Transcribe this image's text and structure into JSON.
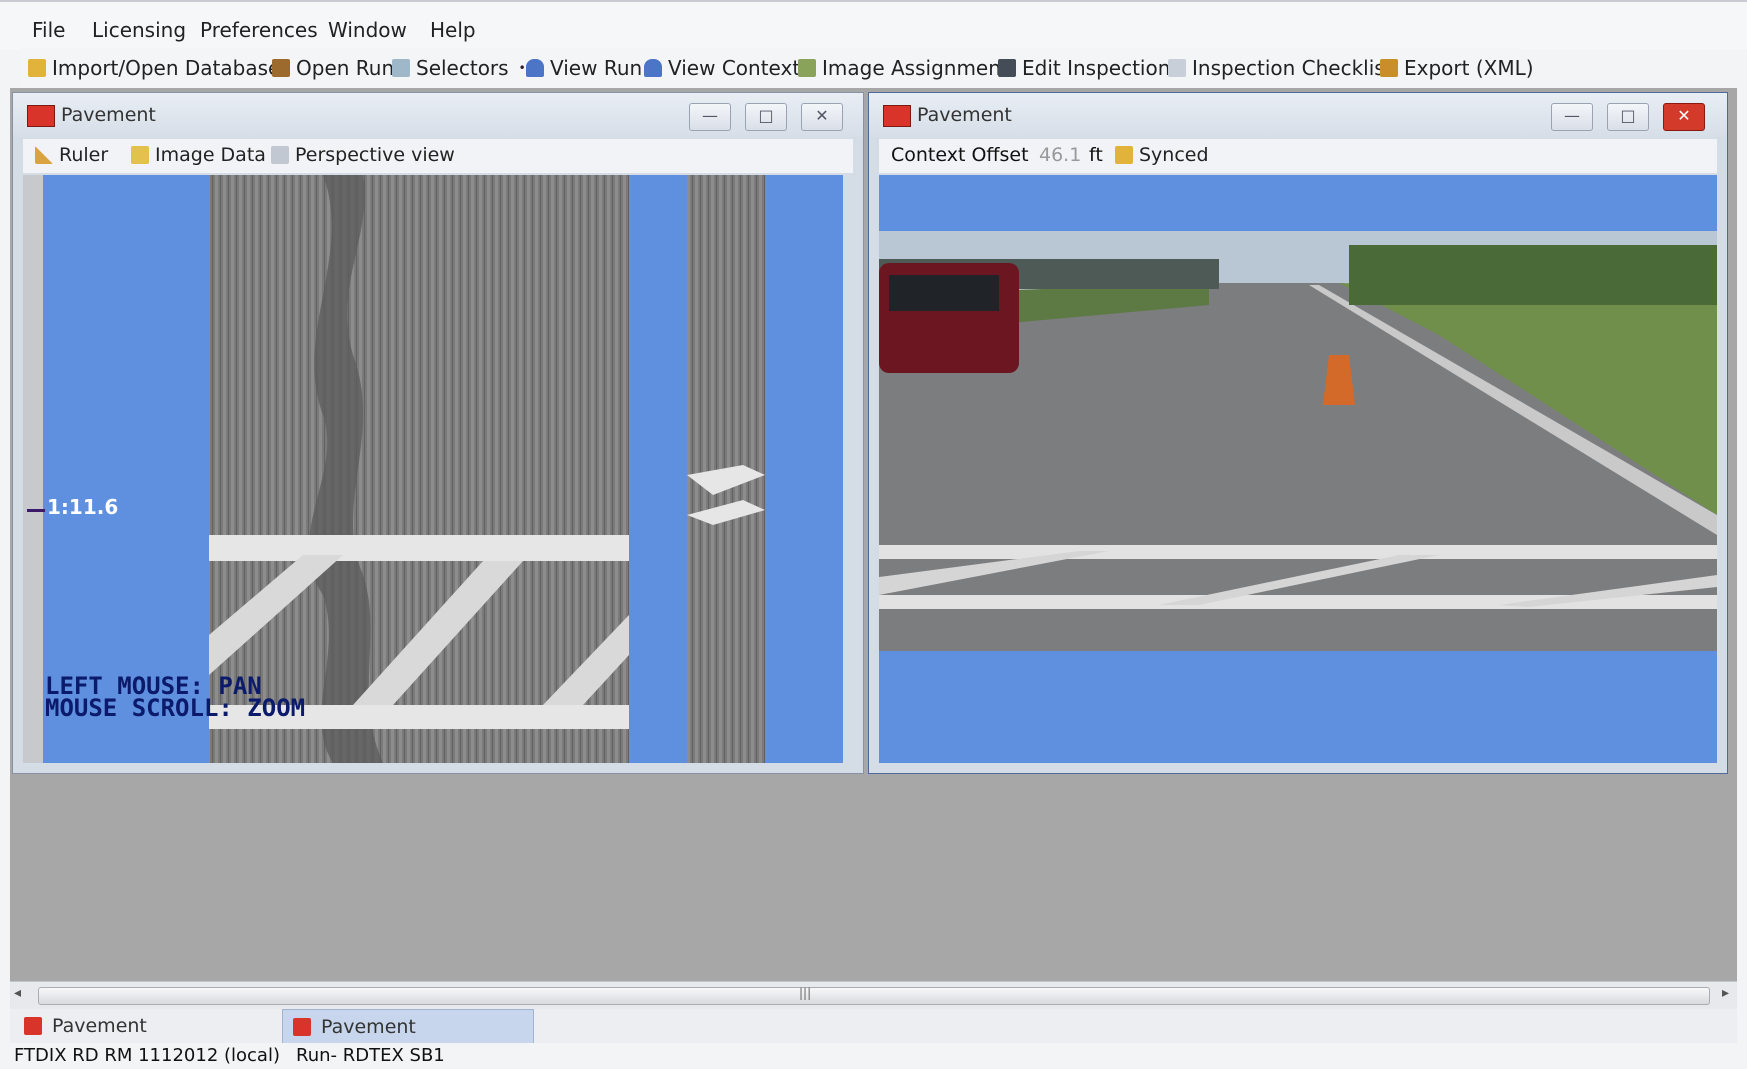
{
  "menu": [
    "File",
    "Licensing",
    "Preferences",
    "Window",
    "Help"
  ],
  "toolbar": {
    "import_db": "Import/Open Database",
    "open_run": "Open Run",
    "selectors": "Selectors",
    "dropdown_arrow": "•",
    "view_run": "View Run",
    "view_context": "View Context",
    "image_assignment": "Image Assignment",
    "edit_inspection": "Edit Inspection",
    "inspection_checklist": "Inspection Checklist",
    "export_xml": "Export (XML)"
  },
  "left_pane": {
    "title": "Pavement",
    "tools": {
      "ruler": "Ruler",
      "image_data": "Image Data",
      "perspective_view": "Perspective view"
    },
    "scale_label": "1:11.6",
    "hint_line1": "LEFT MOUSE: PAN",
    "hint_line2": "MOUSE SCROLL: ZOOM",
    "buttons": {
      "minimize": "—",
      "maximize": "□",
      "close": "✕"
    }
  },
  "right_pane": {
    "title": "Pavement",
    "context_offset_label": "Context Offset",
    "context_offset_value": "46.1",
    "unit": "ft",
    "synced_label": "Synced",
    "buttons": {
      "minimize": "—",
      "maximize": "□",
      "close": "✕"
    }
  },
  "scrollbar": {
    "left_arrow": "◂",
    "right_arrow": "▸",
    "grip": "|||"
  },
  "tabs": [
    "Pavement",
    "Pavement"
  ],
  "status": {
    "database": "FTDIX RD RM 1112012 (local)",
    "run": "Run- RDTEX SB1"
  },
  "colors": {
    "viewport_blue": "#5f8fdf",
    "close_red": "#d8342a",
    "workspace_gray": "#a7a7a7",
    "hint_navy": "#0b1a6a"
  },
  "icons": [
    "database-icon",
    "run-icon",
    "selectors-icon",
    "car-icon",
    "image-icon",
    "clipboard-icon",
    "checklist-icon",
    "export-icon",
    "ruler-icon",
    "image-data-icon",
    "perspective-icon",
    "sync-lock-icon",
    "app-icon"
  ]
}
